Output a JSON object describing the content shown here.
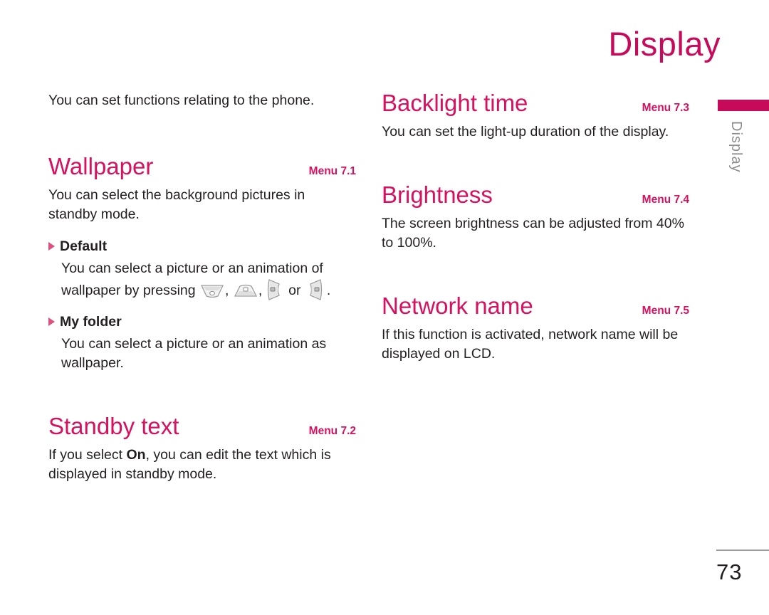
{
  "page": {
    "title": "Display",
    "side_tab_label": "Display",
    "page_number": "73"
  },
  "colors": {
    "accent": "#c80a5a",
    "heading": "#d8115f",
    "bullet": "#e0507f",
    "text": "#231f20",
    "side_tab_text": "#8d8d8d"
  },
  "left_column": {
    "intro": "You can set functions relating to the phone.",
    "sections": [
      {
        "title": "Wallpaper",
        "menu": "Menu 7.1",
        "body": "You can select the background pictures in standby mode.",
        "bullets": [
          {
            "title": "Default",
            "body_before": "You can select a picture or an animation of wallpaper by pressing",
            "icons": [
              "nav-key-up-icon",
              "nav-key-down-icon",
              "nav-key-left-icon",
              "nav-key-right-icon"
            ],
            "separator_1": ",",
            "separator_2": ",",
            "conjunction": "or",
            "body_after": "."
          },
          {
            "title": "My folder",
            "body": "You can select a picture or an animation as wallpaper."
          }
        ]
      },
      {
        "title": "Standby text",
        "menu": "Menu 7.2",
        "body_part_1": "If you select ",
        "body_bold": "On",
        "body_part_2": ", you can edit the text which is displayed in standby mode."
      }
    ]
  },
  "right_column": {
    "sections": [
      {
        "title": "Backlight time",
        "menu": "Menu 7.3",
        "body": "You can set the light-up duration of the display."
      },
      {
        "title": "Brightness",
        "menu": "Menu 7.4",
        "body": "The screen brightness can be adjusted from 40% to 100%."
      },
      {
        "title": "Network name",
        "menu": "Menu 7.5",
        "body": "If this function is activated, network name will be displayed on LCD."
      }
    ]
  }
}
